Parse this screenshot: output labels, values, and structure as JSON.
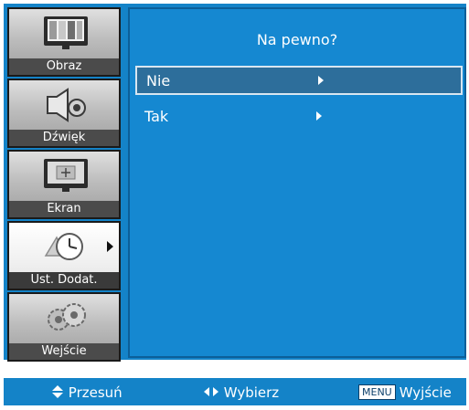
{
  "sidebar": {
    "items": [
      {
        "label": "Obraz",
        "icon": "picture-icon",
        "active": false
      },
      {
        "label": "Dźwięk",
        "icon": "speaker-icon",
        "active": false
      },
      {
        "label": "Ekran",
        "icon": "screen-icon",
        "active": false
      },
      {
        "label": "Ust. Dodat.",
        "icon": "clock-icon",
        "active": true
      },
      {
        "label": "Wejście",
        "icon": "gears-icon",
        "active": false
      }
    ]
  },
  "panel": {
    "title": "Na pewno?",
    "options": [
      {
        "label": "Nie",
        "selected": true
      },
      {
        "label": "Tak",
        "selected": false
      }
    ]
  },
  "helpbar": {
    "move_label": "Przesuń",
    "select_label": "Wybierz",
    "menu_key": "MENU",
    "exit_label": "Wyjście"
  },
  "colors": {
    "background": "#1483c8",
    "selected_row": "#2d6e9b",
    "text": "#ffffff"
  }
}
